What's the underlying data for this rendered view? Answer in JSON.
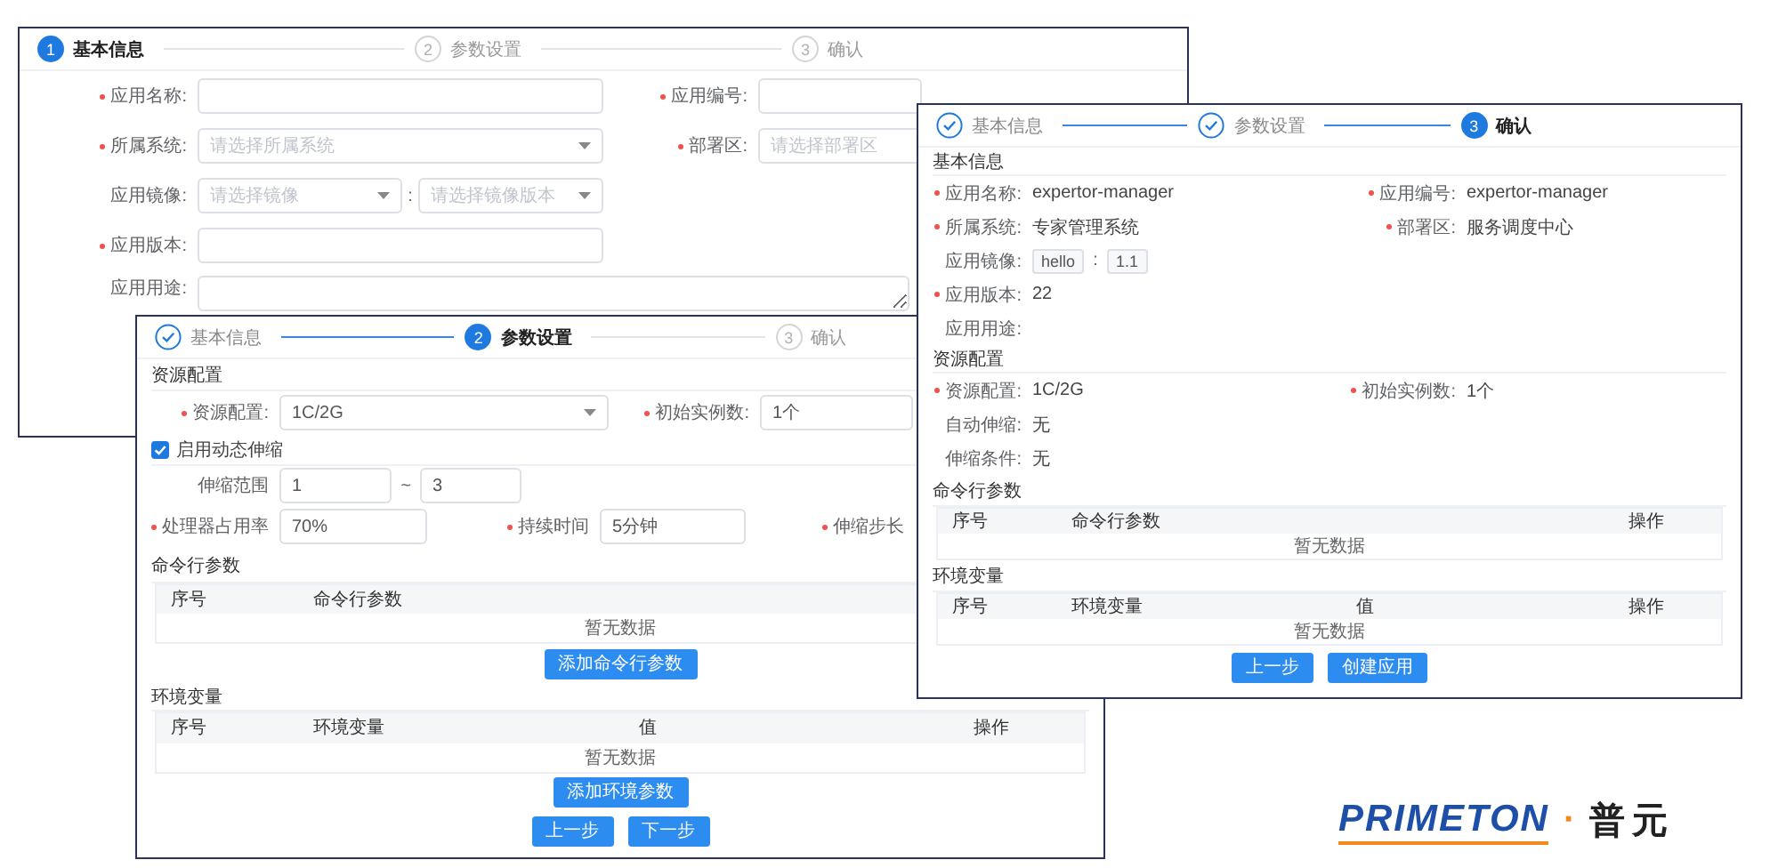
{
  "basic_info_window": {
    "steps": [
      {
        "number": "1",
        "label": "基本信息",
        "kind": "current"
      },
      {
        "number": "2",
        "label": "参数设置",
        "kind": "pending"
      },
      {
        "number": "3",
        "label": "确认",
        "kind": "pending"
      }
    ],
    "rows": [
      [
        {
          "label": "应用名称:",
          "required": true,
          "kind": "input"
        },
        {
          "label": "应用编号:",
          "required": true,
          "kind": "input"
        }
      ],
      [
        {
          "label": "所属系统:",
          "required": true,
          "kind": "select",
          "placeholder": "请选择所属系统"
        },
        {
          "label": "部署区:",
          "required": true,
          "kind": "input",
          "placeholder": "请选择部署区"
        }
      ],
      [
        {
          "label": "应用镜像:",
          "required": false,
          "kind": "select_pair",
          "placeholder": "请选择镜像",
          "separator": ":",
          "placeholder_2": "请选择镜像版本"
        }
      ],
      [
        {
          "label": "应用版本:",
          "required": true,
          "kind": "input"
        }
      ],
      [
        {
          "label": "应用用途:",
          "required": false,
          "kind": "textarea"
        }
      ]
    ]
  },
  "params_window": {
    "steps": [
      {
        "label": "基本信息",
        "kind": "done"
      },
      {
        "number": "2",
        "label": "参数设置",
        "kind": "current"
      },
      {
        "number": "3",
        "label": "确认",
        "kind": "pending"
      }
    ],
    "resource_title": "资源配置",
    "resource_row": [
      {
        "label": "资源配置:",
        "required": true,
        "kind": "select",
        "value": "1C/2G"
      },
      {
        "label": "初始实例数:",
        "required": true,
        "kind": "input",
        "value": "1个"
      }
    ],
    "autoscale": {
      "label": "启用动态伸缩",
      "checked": true
    },
    "scale_range": {
      "label": "伸缩范围",
      "from": "1",
      "separator": "~",
      "to": "3"
    },
    "scale_rule": [
      {
        "label": "处理器占用率",
        "required": true,
        "value": "70%"
      },
      {
        "label": "持续时间",
        "required": true,
        "value": "5分钟"
      },
      {
        "label": "伸缩步长",
        "required": true
      }
    ],
    "command_title": "命令行参数",
    "command_table": {
      "columns": [
        "序号",
        "命令行参数"
      ],
      "empty_text": "暂无数据"
    },
    "add_command_button": "添加命令行参数",
    "env_title": "环境变量",
    "env_table": {
      "columns": [
        "序号",
        "环境变量",
        "值",
        "操作"
      ],
      "empty_text": "暂无数据"
    },
    "add_env_button": "添加环境参数",
    "buttons": [
      "上一步",
      "下一步"
    ]
  },
  "confirm_window": {
    "steps": [
      {
        "label": "基本信息",
        "kind": "done"
      },
      {
        "label": "参数设置",
        "kind": "done"
      },
      {
        "number": "3",
        "label": "确认",
        "kind": "current"
      }
    ],
    "sections": [
      {
        "title": "基本信息",
        "rows": [
          [
            {
              "label": "应用名称:",
              "required": true,
              "value": "expertor-manager"
            },
            {
              "label": "应用编号:",
              "required": true,
              "value": "expertor-manager"
            }
          ],
          [
            {
              "label": "所属系统:",
              "required": true,
              "value": "专家管理系统"
            },
            {
              "label": "部署区:",
              "required": true,
              "value": "服务调度中心"
            }
          ],
          [
            {
              "label": "应用镜像:",
              "required": false,
              "tags": [
                "hello",
                "1.1"
              ],
              "separator": ":"
            }
          ],
          [
            {
              "label": "应用版本:",
              "required": true,
              "value": "22"
            }
          ],
          [
            {
              "label": "应用用途:",
              "required": false
            }
          ]
        ]
      },
      {
        "title": "资源配置",
        "rows": [
          [
            {
              "label": "资源配置:",
              "required": true,
              "value": "1C/2G"
            },
            {
              "label": "初始实例数:",
              "required": true,
              "value": "1个"
            }
          ],
          [
            {
              "label": "自动伸缩:",
              "required": false,
              "value": "无"
            }
          ],
          [
            {
              "label": "伸缩条件:",
              "required": false,
              "value": "无"
            }
          ]
        ]
      }
    ],
    "tables": [
      {
        "title": "命令行参数",
        "columns": [
          "序号",
          "命令行参数",
          "操作"
        ],
        "empty_text": "暂无数据"
      },
      {
        "title": "环境变量",
        "columns": [
          "序号",
          "环境变量",
          "值",
          "操作"
        ],
        "empty_text": "暂无数据"
      }
    ],
    "buttons": [
      "上一步",
      "创建应用"
    ]
  },
  "logo": {
    "wordmark": "PRIMETON",
    "separator": "·",
    "name": "普元"
  }
}
